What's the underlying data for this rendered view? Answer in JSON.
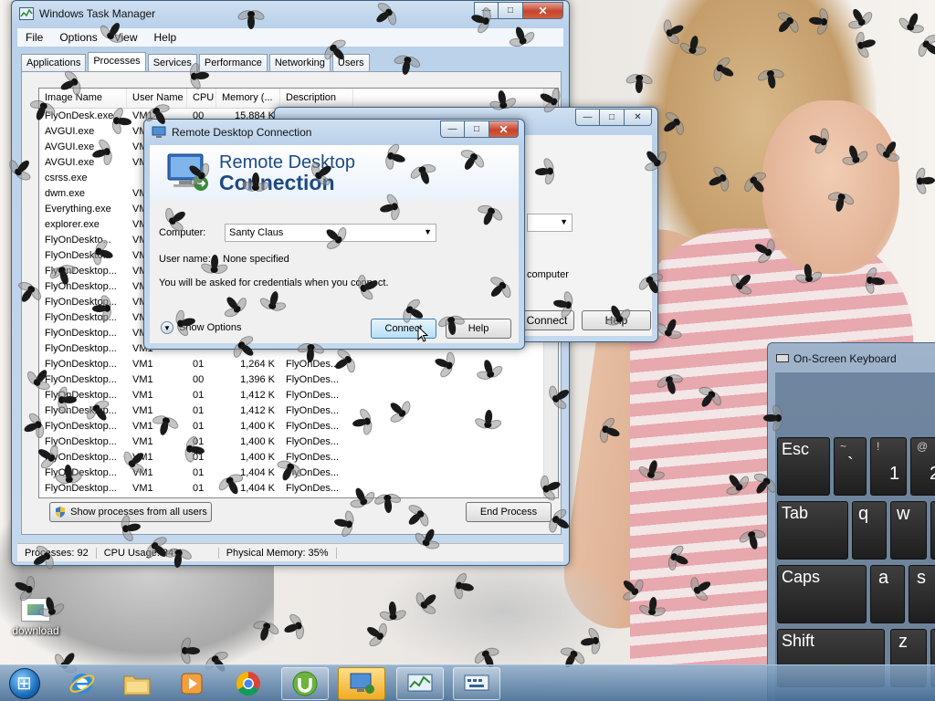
{
  "task_manager": {
    "title": "Windows Task Manager",
    "menu": [
      "File",
      "Options",
      "View",
      "Help"
    ],
    "tabs": [
      "Applications",
      "Processes",
      "Services",
      "Performance",
      "Networking",
      "Users"
    ],
    "active_tab": "Processes",
    "columns": [
      "Image Name",
      "User Name",
      "CPU",
      "Memory (...",
      "Description"
    ],
    "rows": [
      [
        "FlyOnDesk.exe ...",
        "VM1",
        "00",
        "15,884 K",
        ""
      ],
      [
        "AVGUI.exe",
        "VM1",
        "",
        "",
        ""
      ],
      [
        "AVGUI.exe",
        "VM1",
        "",
        "",
        ""
      ],
      [
        "AVGUI.exe",
        "VM1",
        "",
        "",
        ""
      ],
      [
        "csrss.exe",
        "",
        "",
        "",
        ""
      ],
      [
        "dwm.exe",
        "VM1",
        "",
        "",
        ""
      ],
      [
        "Everything.exe",
        "VM1",
        "",
        "",
        ""
      ],
      [
        "explorer.exe",
        "VM1",
        "",
        "",
        ""
      ],
      [
        "FlyOnDeskto...",
        "VM1",
        "",
        "",
        ""
      ],
      [
        "FlyOnDeskto...",
        "VM1",
        "",
        "",
        ""
      ],
      [
        "FlyOnDesktop...",
        "VM1",
        "",
        "",
        ""
      ],
      [
        "FlyOnDesktop...",
        "VM1",
        "",
        "",
        ""
      ],
      [
        "FlyOnDesktop...",
        "VM1",
        "",
        "",
        ""
      ],
      [
        "FlyOnDesktop...",
        "VM1",
        "",
        "",
        ""
      ],
      [
        "FlyOnDesktop...",
        "VM1",
        "",
        "",
        ""
      ],
      [
        "FlyOnDesktop...",
        "VM1",
        "",
        "",
        ""
      ],
      [
        "FlyOnDesktop...",
        "VM1",
        "01",
        "1,264 K",
        "FlyOnDes..."
      ],
      [
        "FlyOnDesktop...",
        "VM1",
        "00",
        "1,396 K",
        "FlyOnDes..."
      ],
      [
        "FlyOnDesktop...",
        "VM1",
        "01",
        "1,412 K",
        "FlyOnDes..."
      ],
      [
        "FlyOnDesktop...",
        "VM1",
        "01",
        "1,412 K",
        "FlyOnDes..."
      ],
      [
        "FlyOnDesktop...",
        "VM1",
        "01",
        "1,400 K",
        "FlyOnDes..."
      ],
      [
        "FlyOnDesktop...",
        "VM1",
        "01",
        "1,400 K",
        "FlyOnDes..."
      ],
      [
        "FlyOnDesktop...",
        "VM1",
        "01",
        "1,400 K",
        "FlyOnDes..."
      ],
      [
        "FlyOnDesktop...",
        "VM1",
        "01",
        "1,404 K",
        "FlyOnDes..."
      ],
      [
        "FlyOnDesktop...",
        "VM1",
        "01",
        "1,404 K",
        "FlyOnDes..."
      ]
    ],
    "show_all_button": "Show processes from all users",
    "end_process_button": "End Process",
    "status_processes": "Processes: 92",
    "status_cpu": "CPU Usage: 34%",
    "status_memory": "Physical Memory: 35%"
  },
  "rdc_back": {
    "checkbox_label": "computer",
    "connect_button": "Connect",
    "help_button": "Help"
  },
  "rdc": {
    "title": "Remote Desktop Connection",
    "banner_line1": "Remote Desktop",
    "banner_line2": "Connection",
    "computer_label": "Computer:",
    "computer_value": "Santy Claus",
    "username_label": "User name:",
    "username_value": "None specified",
    "note": "You will be asked for credentials when you connect.",
    "show_options": "Show Options",
    "connect_button": "Connect",
    "help_button": "Help"
  },
  "osk": {
    "title": "On-Screen Keyboard",
    "keys": {
      "esc": "Esc",
      "tilde_top": "~",
      "tilde_bottom": "`",
      "excl_top": "!",
      "excl_bottom": "1",
      "at_top": "@",
      "at_bottom": "2",
      "tab": "Tab",
      "q": "q",
      "w": "w",
      "caps": "Caps",
      "a": "a",
      "s": "s",
      "shift": "Shift",
      "z": "z"
    }
  },
  "desktop": {
    "icon_label": "download"
  },
  "taskbar": {
    "items": [
      "start-orb",
      "internet-explorer",
      "windows-explorer",
      "media-player",
      "chrome",
      "utorrent",
      "remote-desktop",
      "task-manager",
      "on-screen-keyboard"
    ]
  },
  "colors": {
    "rdc_banner_text": "#1d4a84",
    "close_button": "#c7432b",
    "taskbar_active": "#f0ab24"
  }
}
